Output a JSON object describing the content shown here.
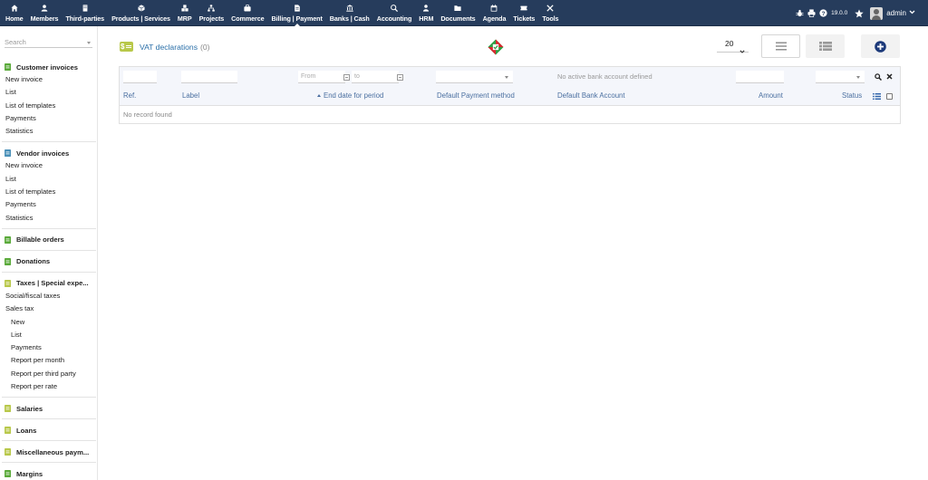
{
  "topnav": [
    {
      "key": "home",
      "label": "Home",
      "icon": "home-icon"
    },
    {
      "key": "members",
      "label": "Members",
      "icon": "user-icon"
    },
    {
      "key": "thirdparties",
      "label": "Third-parties",
      "icon": "building-icon"
    },
    {
      "key": "products",
      "label": "Products | Services",
      "icon": "cube-icon"
    },
    {
      "key": "mrp",
      "label": "MRP",
      "icon": "cubes-icon"
    },
    {
      "key": "projects",
      "label": "Projects",
      "icon": "sitemap-icon"
    },
    {
      "key": "commerce",
      "label": "Commerce",
      "icon": "suitcase-icon"
    },
    {
      "key": "billing",
      "label": "Billing | Payment",
      "icon": "file-invoice-icon",
      "active": true
    },
    {
      "key": "banks",
      "label": "Banks | Cash",
      "icon": "bank-icon"
    },
    {
      "key": "accounting",
      "label": "Accounting",
      "icon": "search-dollar-icon"
    },
    {
      "key": "hrm",
      "label": "HRM",
      "icon": "person-icon"
    },
    {
      "key": "documents",
      "label": "Documents",
      "icon": "folder-icon"
    },
    {
      "key": "agenda",
      "label": "Agenda",
      "icon": "calendar-icon"
    },
    {
      "key": "tickets",
      "label": "Tickets",
      "icon": "ticket-icon"
    },
    {
      "key": "tools",
      "label": "Tools",
      "icon": "tools-icon"
    }
  ],
  "topright": {
    "version": "19.0.0",
    "user": "admin"
  },
  "sidebar": {
    "search_placeholder": "Search",
    "groups": [
      {
        "label": "Customer invoices",
        "icon_color": "#5aaa3a",
        "items": [
          {
            "label": "New invoice"
          },
          {
            "label": "List"
          },
          {
            "label": "List of templates"
          },
          {
            "label": "Payments"
          },
          {
            "label": "Statistics"
          }
        ]
      },
      {
        "label": "Vendor invoices",
        "icon_color": "#4a90b8",
        "items": [
          {
            "label": "New invoice"
          },
          {
            "label": "List"
          },
          {
            "label": "List of templates"
          },
          {
            "label": "Payments"
          },
          {
            "label": "Statistics"
          }
        ]
      },
      {
        "label": "Billable orders",
        "icon_color": "#5aaa3a",
        "items": []
      },
      {
        "label": "Donations",
        "icon_color": "#5aaa3a",
        "items": []
      },
      {
        "label": "Taxes | Special expe...",
        "icon_color": "#b8c84a",
        "items": [
          {
            "label": "Social/fiscal taxes"
          },
          {
            "label": "Sales tax"
          },
          {
            "label": "New",
            "sub": true
          },
          {
            "label": "List",
            "sub": true
          },
          {
            "label": "Payments",
            "sub": true
          },
          {
            "label": "Report per month",
            "sub": true
          },
          {
            "label": "Report per third party",
            "sub": true
          },
          {
            "label": "Report per rate",
            "sub": true
          }
        ]
      },
      {
        "label": "Salaries",
        "icon_color": "#b8c84a",
        "items": []
      },
      {
        "label": "Loans",
        "icon_color": "#b8c84a",
        "items": []
      },
      {
        "label": "Miscellaneous paym...",
        "icon_color": "#b8c84a",
        "items": []
      },
      {
        "label": "Margins",
        "icon_color": "#5aaa3a",
        "items": []
      }
    ]
  },
  "page": {
    "title": "VAT declarations",
    "count": "(0)",
    "page_size": "20",
    "filters": {
      "from_placeholder": "From",
      "to_placeholder": "to",
      "no_bank": "No active bank account defined"
    },
    "columns": {
      "ref": "Ref.",
      "label": "Label",
      "end_date": "End date for period",
      "payment_method": "Default Payment method",
      "bank_account": "Default Bank Account",
      "amount": "Amount",
      "status": "Status"
    },
    "empty": "No record found"
  }
}
